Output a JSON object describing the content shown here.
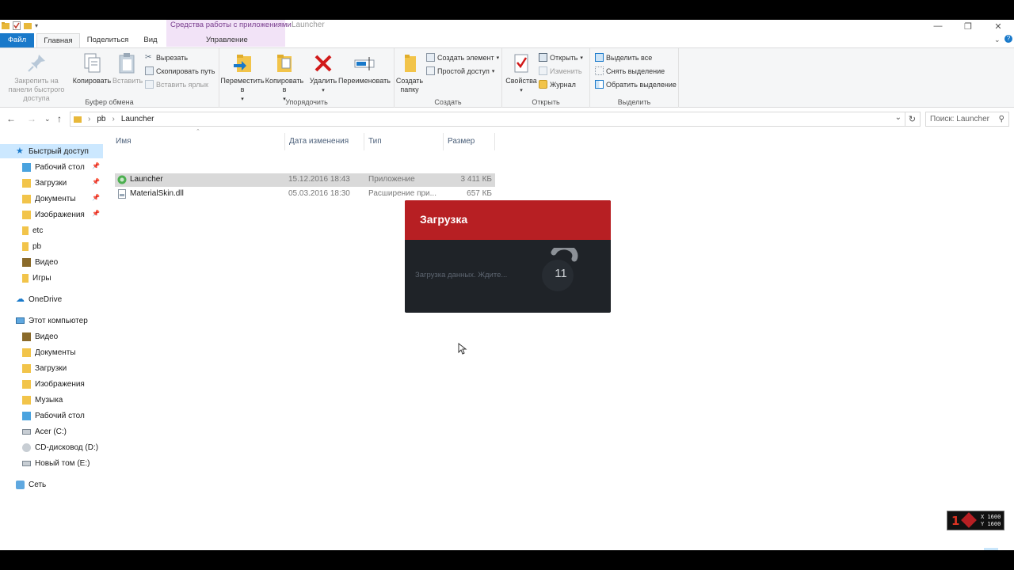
{
  "titlebar": {
    "context_tab": "Средства работы с приложениями",
    "window_title": "Launcher",
    "context_sub": "Управление"
  },
  "tabs": {
    "file": "Файл",
    "home": "Главная",
    "share": "Поделиться",
    "view": "Вид"
  },
  "ribbon": {
    "clipboard": {
      "label": "Буфер обмена",
      "pin": "Закрепить на панели быстрого доступа",
      "copy": "Копировать",
      "paste": "Вставить",
      "cut": "Вырезать",
      "copy_path": "Скопировать путь",
      "paste_shortcut": "Вставить ярлык"
    },
    "organize": {
      "label": "Упорядочить",
      "move": "Переместить в",
      "copy_to": "Копировать в",
      "delete": "Удалить",
      "rename": "Переименовать"
    },
    "create": {
      "label": "Создать",
      "new_folder": "Создать папку",
      "new_item": "Создать элемент",
      "easy_access": "Простой доступ"
    },
    "open": {
      "label": "Открыть",
      "properties": "Свойства",
      "open": "Открыть",
      "edit": "Изменить",
      "history": "Журнал"
    },
    "select": {
      "label": "Выделить",
      "select_all": "Выделить все",
      "select_none": "Снять выделение",
      "invert": "Обратить выделение"
    }
  },
  "address": {
    "path": [
      "pb",
      "Launcher"
    ],
    "search_placeholder": "Поиск: Launcher"
  },
  "sidebar": {
    "quick_access": "Быстрый доступ",
    "quick_items": [
      "Рабочий стол",
      "Загрузки",
      "Документы",
      "Изображения",
      "etc",
      "pb",
      "Видео",
      "Игры"
    ],
    "onedrive": "OneDrive",
    "this_pc": "Этот компьютер",
    "pc_items": [
      "Видео",
      "Документы",
      "Загрузки",
      "Изображения",
      "Музыка",
      "Рабочий стол",
      "Acer (C:)",
      "CD-дисковод (D:)",
      "Новый том (E:)"
    ],
    "network": "Сеть"
  },
  "files": {
    "columns": [
      "Имя",
      "Дата изменения",
      "Тип",
      "Размер"
    ],
    "rows": [
      {
        "name": "Launcher",
        "date": "15.12.2016 18:43",
        "type": "Приложение",
        "size": "3 411 КБ"
      },
      {
        "name": "MaterialSkin.dll",
        "date": "05.03.2016 18:30",
        "type": "Расширение при...",
        "size": "657 КБ"
      }
    ]
  },
  "loader": {
    "title": "Загрузка",
    "message": "Загрузка данных. Ждите...",
    "counter": "11",
    "accent": "#b71f23"
  },
  "hud": {
    "number": "1",
    "x": "X 1600",
    "y": "Y 1600"
  }
}
